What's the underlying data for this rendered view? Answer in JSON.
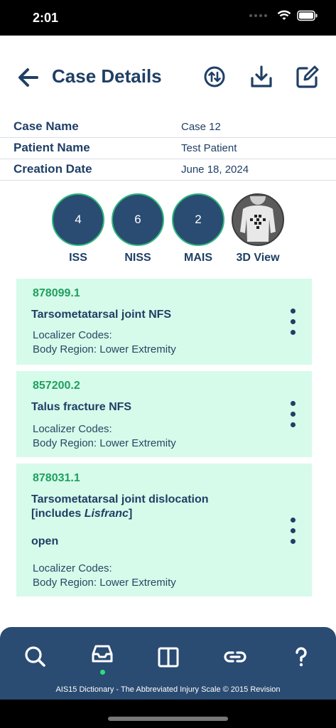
{
  "status": {
    "time": "2:01"
  },
  "header": {
    "title": "Case Details"
  },
  "info": {
    "rows": [
      {
        "label": "Case Name",
        "value": "Case 12"
      },
      {
        "label": "Patient Name",
        "value": "Test Patient"
      },
      {
        "label": "Creation Date",
        "value": "June 18, 2024"
      }
    ]
  },
  "scores": [
    {
      "value": "4",
      "label": "ISS"
    },
    {
      "value": "6",
      "label": "NISS"
    },
    {
      "value": "2",
      "label": "MAIS"
    }
  ],
  "view3d": {
    "label": "3D View"
  },
  "injuries": [
    {
      "code": "878099.1",
      "title": "Tarsometatarsal joint NFS",
      "localizer": "Localizer Codes:",
      "region": "Body Region: Lower Extremity"
    },
    {
      "code": "857200.2",
      "title": "Talus fracture NFS",
      "localizer": "Localizer Codes:",
      "region": "Body Region: Lower Extremity"
    },
    {
      "code": "878031.1",
      "title_line1": "Tarsometatarsal joint dislocation",
      "title_line2_prefix": "[includes ",
      "title_line2_italic": "Lisfranc",
      "title_line2_suffix": "]",
      "subtitle": "open",
      "localizer": "Localizer Codes:",
      "region": "Body Region: Lower Extremity"
    }
  ],
  "footer": {
    "text": "AIS15 Dictionary - The Abbreviated Injury Scale © 2015 Revision"
  },
  "colors": {
    "accent": "#2a4b72",
    "code_green": "#1fa05d",
    "card_bg": "#d6fbea"
  }
}
